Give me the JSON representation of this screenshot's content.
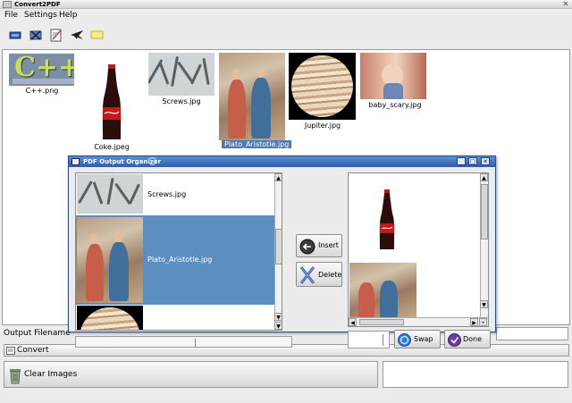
{
  "window": {
    "title": "Convert2PDF"
  },
  "menu": {
    "file": "File",
    "settings": "Settings",
    "help": "Help"
  },
  "toolbar": [
    "image-icon",
    "close-icon",
    "edit-icon",
    "plane-icon",
    "note-icon"
  ],
  "gallery": {
    "items": [
      {
        "caption": "C++.png",
        "picture_text": "C++"
      },
      {
        "caption": "Coke.jpeg"
      },
      {
        "caption": "Screws.jpg"
      },
      {
        "caption": "Plato_Aristotle.jpg",
        "selected": true
      },
      {
        "caption": "Jupiter.jpg"
      },
      {
        "caption": "baby_scary.jpg"
      }
    ]
  },
  "controls": {
    "output_filename_label": "Output Filename",
    "convert_label": "Convert",
    "clear_images_label": "Clear Images"
  },
  "dialog": {
    "title": "PDF Output Organizer",
    "left_list": [
      {
        "label": "Screws.jpg"
      },
      {
        "label": "Plato_Aristotle.jpg",
        "selected": true
      },
      {
        "label": ""
      }
    ],
    "insert_label": "Insert",
    "delete_label": "Delete",
    "swap_label": "Swap",
    "done_label": "Done"
  },
  "colors": {
    "selection": "#5d8ec0",
    "titlebar": "#3a6cb4",
    "caption_selected": "#4f7bb0"
  }
}
